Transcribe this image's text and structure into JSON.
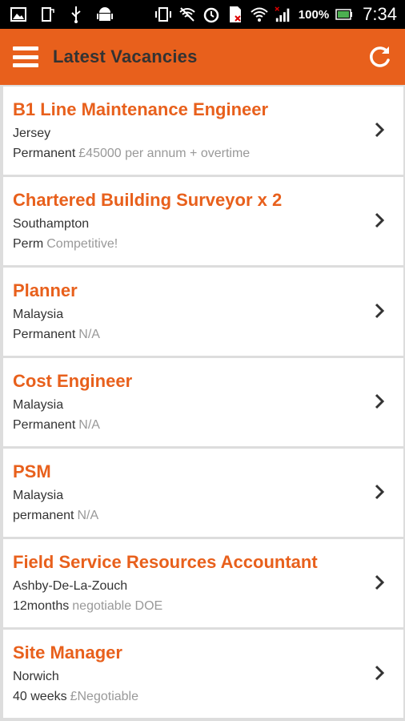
{
  "status_bar": {
    "battery_percent": "100%",
    "time": "7:34"
  },
  "app_bar": {
    "title": "Latest Vacancies"
  },
  "colors": {
    "accent": "#e8601c"
  },
  "vacancies": [
    {
      "title": "B1 Line Maintenance Engineer",
      "location": "Jersey",
      "type": "Permanent",
      "salary": "£45000 per annum + overtime"
    },
    {
      "title": "Chartered Building Surveyor x 2",
      "location": "Southampton",
      "type": "Perm",
      "salary": "Competitive!"
    },
    {
      "title": "Planner",
      "location": "Malaysia",
      "type": "Permanent",
      "salary": "N/A"
    },
    {
      "title": "Cost Engineer",
      "location": "Malaysia",
      "type": "Permanent",
      "salary": "N/A"
    },
    {
      "title": "PSM",
      "location": "Malaysia",
      "type": "permanent",
      "salary": "N/A"
    },
    {
      "title": "Field Service Resources Accountant",
      "location": "Ashby-De-La-Zouch",
      "type": "12months",
      "salary": "negotiable DOE"
    },
    {
      "title": "Site Manager",
      "location": "Norwich",
      "type": "40 weeks",
      "salary": "£Negotiable"
    }
  ]
}
